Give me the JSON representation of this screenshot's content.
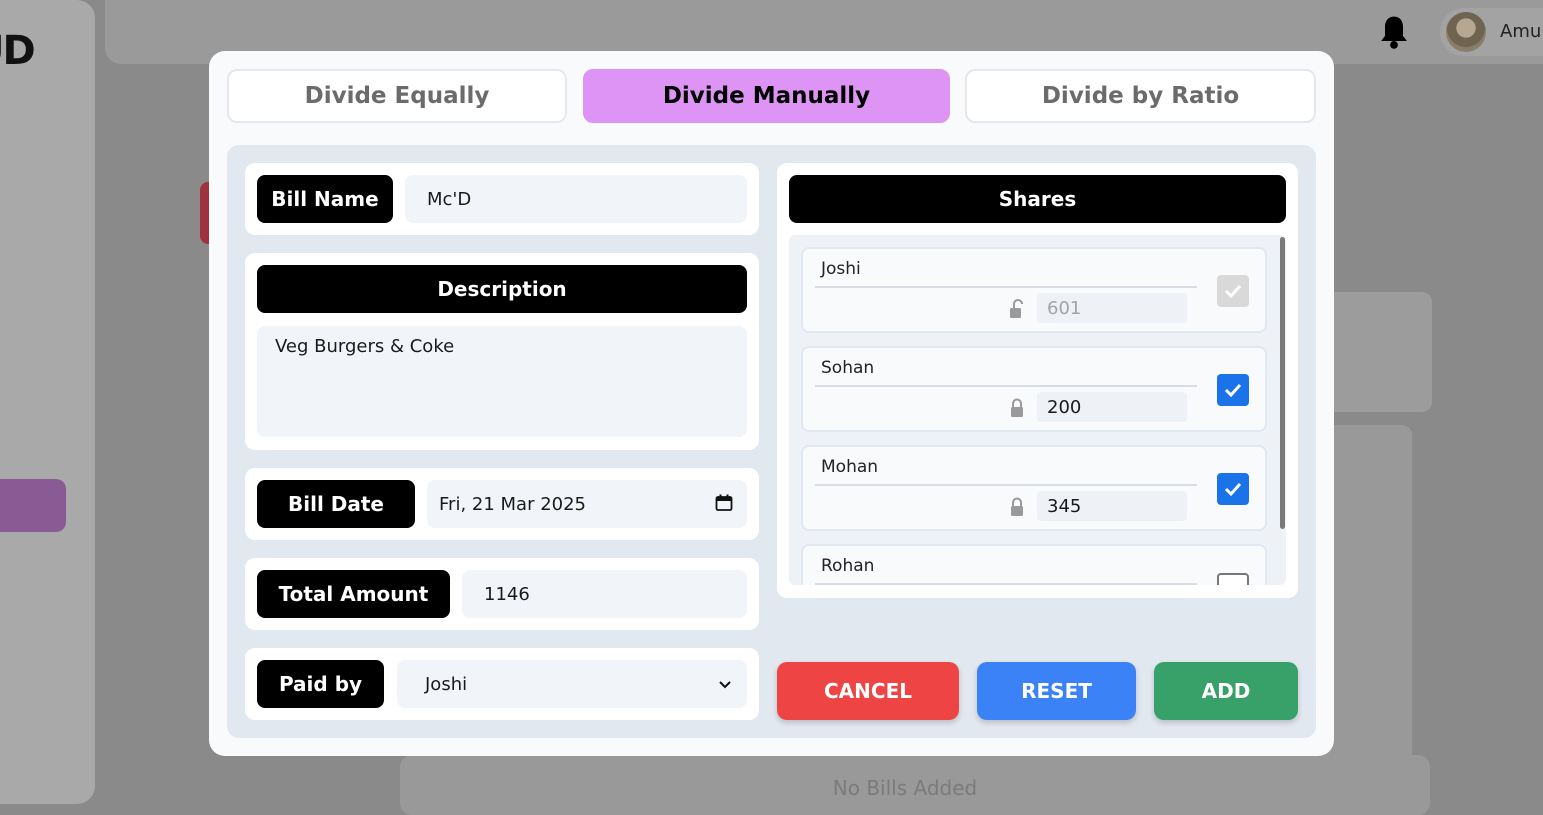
{
  "background": {
    "logo_text": "UD",
    "username": "Amu",
    "empty_message": "No Bills Added"
  },
  "tabs": [
    {
      "label": "Divide Equally",
      "active": false
    },
    {
      "label": "Divide Manually",
      "active": true
    },
    {
      "label": "Divide by Ratio",
      "active": false
    }
  ],
  "form": {
    "bill_name_label": "Bill Name",
    "bill_name_value": "Mc'D",
    "description_label": "Description",
    "description_value": "Veg Burgers & Coke",
    "bill_date_label": "Bill Date",
    "bill_date_value": "Fri, 21 Mar 2025",
    "total_amount_label": "Total Amount",
    "total_amount_value": "1146",
    "paid_by_label": "Paid by",
    "paid_by_value": "Joshi"
  },
  "shares": {
    "title": "Shares",
    "items": [
      {
        "name": "Joshi",
        "amount": "601",
        "locked": false,
        "checked": true,
        "disabled": true
      },
      {
        "name": "Sohan",
        "amount": "200",
        "locked": true,
        "checked": true,
        "disabled": false
      },
      {
        "name": "Mohan",
        "amount": "345",
        "locked": true,
        "checked": true,
        "disabled": false
      },
      {
        "name": "Rohan",
        "amount": "",
        "locked": true,
        "checked": false,
        "disabled": false
      }
    ]
  },
  "buttons": {
    "cancel_label": "CANCEL",
    "reset_label": "RESET",
    "add_label": "ADD"
  },
  "colors": {
    "active_tab": "#dd94f4",
    "cancel": "#ef4444",
    "reset": "#3b82f6",
    "add": "#38a169",
    "checkbox": "#1a73e8"
  }
}
